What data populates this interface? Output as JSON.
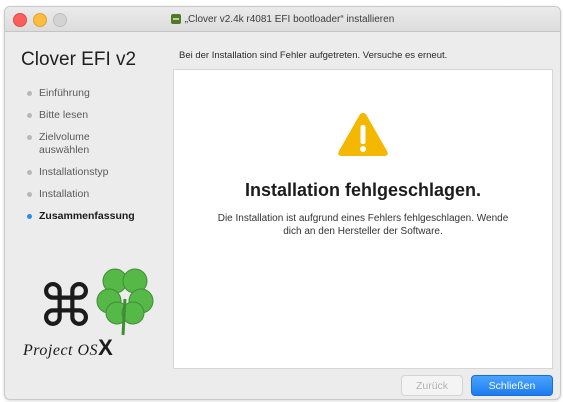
{
  "window": {
    "title": "„Clover v2.4k r4081 EFI bootloader“ installieren",
    "app_icon": "package-icon"
  },
  "sidebar": {
    "app_title": "Clover EFI v2",
    "steps": [
      {
        "label": "Einführung",
        "active": false
      },
      {
        "label": "Bitte lesen",
        "active": false
      },
      {
        "label": "Zielvolume auswählen",
        "active": false
      },
      {
        "label": "Installationstyp",
        "active": false
      },
      {
        "label": "Installation",
        "active": false
      },
      {
        "label": "Zusammenfassung",
        "active": true
      }
    ],
    "logo": {
      "text_prefix": "Project OS",
      "text_x": "X",
      "icons": [
        "command-key-icon",
        "four-leaf-clover-icon"
      ]
    }
  },
  "main": {
    "error_banner": "Bei der Installation sind Fehler aufgetreten. Versuche es erneut.",
    "status_icon": "warning-triangle-icon",
    "headline": "Installation fehlgeschlagen.",
    "message": "Die Installation ist aufgrund eines Fehlers fehlgeschlagen. Wende dich an den Hersteller der Software."
  },
  "buttons": {
    "back_label": "Zurück",
    "close_label": "Schließen"
  },
  "colors": {
    "accent": "#2a8cf0",
    "warning": "#f5b800",
    "close_button": "#1c7cf0",
    "clover_green": "#56b847"
  }
}
